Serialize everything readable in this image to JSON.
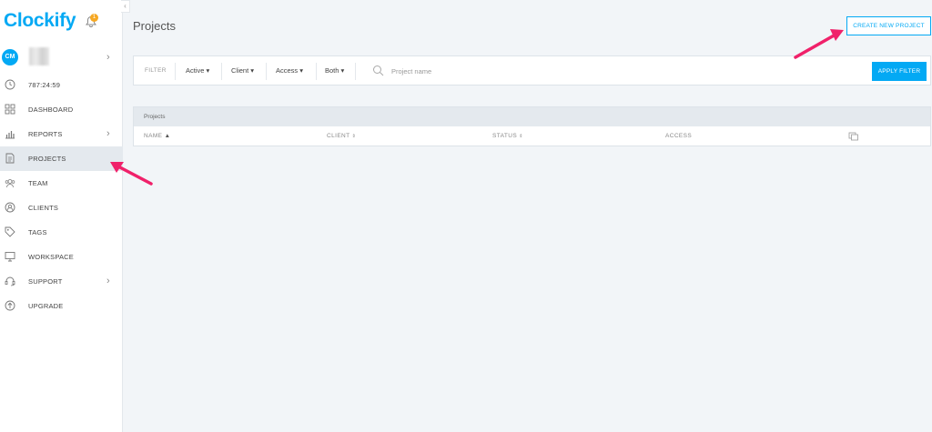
{
  "app": {
    "logo": "Clockify",
    "notification_count": "1"
  },
  "user": {
    "initials": "CM"
  },
  "sidebar": {
    "items": [
      {
        "label": "787:24:59",
        "icon": "clock-icon",
        "chevron": false,
        "active": false
      },
      {
        "label": "DASHBOARD",
        "icon": "dashboard-grid-icon",
        "chevron": false,
        "active": false
      },
      {
        "label": "REPORTS",
        "icon": "bar-chart-icon",
        "chevron": true,
        "active": false
      },
      {
        "label": "PROJECTS",
        "icon": "document-icon",
        "chevron": false,
        "active": true
      },
      {
        "label": "TEAM",
        "icon": "team-icon",
        "chevron": false,
        "active": false
      },
      {
        "label": "CLIENTS",
        "icon": "client-icon",
        "chevron": false,
        "active": false
      },
      {
        "label": "TAGS",
        "icon": "tag-icon",
        "chevron": false,
        "active": false
      },
      {
        "label": "WORKSPACE",
        "icon": "monitor-icon",
        "chevron": false,
        "active": false
      },
      {
        "label": "SUPPORT",
        "icon": "headset-icon",
        "chevron": true,
        "active": false
      },
      {
        "label": "UPGRADE",
        "icon": "upgrade-arrow-icon",
        "chevron": false,
        "active": false
      }
    ]
  },
  "main": {
    "title": "Projects",
    "create_button": "CREATE NEW PROJECT"
  },
  "filter": {
    "label": "FILTER",
    "status": "Active",
    "client": "Client",
    "access": "Access",
    "billing": "Both",
    "search_placeholder": "Project name",
    "apply_button": "APPLY FILTER"
  },
  "table": {
    "title": "Projects",
    "columns": [
      "NAME",
      "CLIENT",
      "STATUS",
      "ACCESS"
    ]
  },
  "colors": {
    "accent": "#03a9f4",
    "highlight_arrow": "#f0216a",
    "background": "#f2f5f8"
  }
}
